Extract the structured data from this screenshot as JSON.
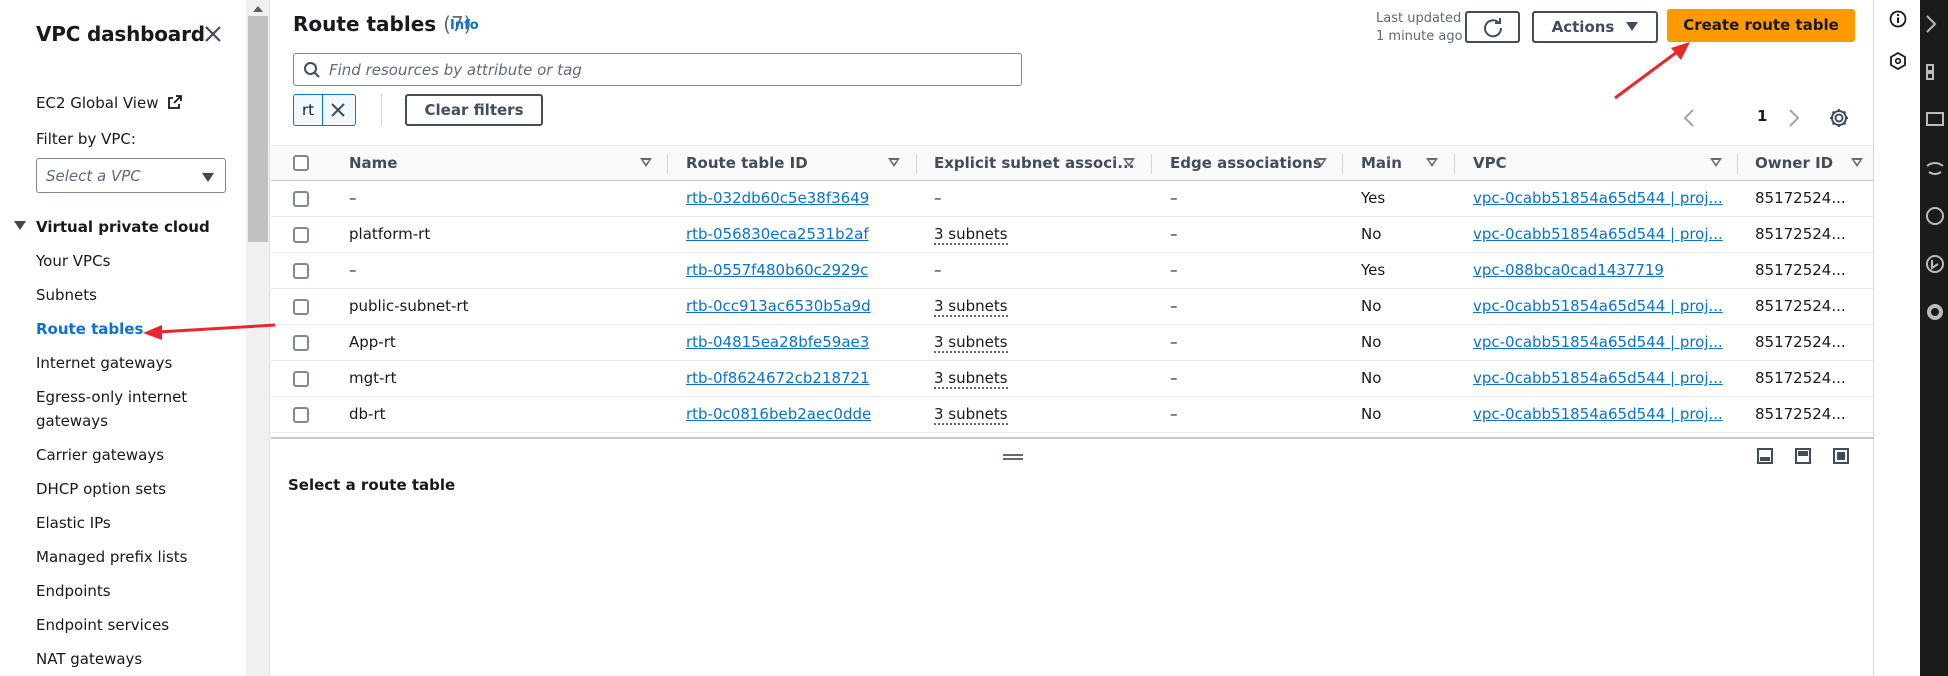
{
  "sidebar": {
    "title": "VPC dashboard",
    "ec2_global_view": "EC2 Global View",
    "filter_label": "Filter by VPC:",
    "vpc_select_placeholder": "Select a VPC",
    "section": "Virtual private cloud",
    "items": [
      {
        "label": "Your VPCs"
      },
      {
        "label": "Subnets"
      },
      {
        "label": "Route tables"
      },
      {
        "label": "Internet gateways"
      },
      {
        "label": "Egress-only internet"
      },
      {
        "label": "gateways"
      },
      {
        "label": "Carrier gateways"
      },
      {
        "label": "DHCP option sets"
      },
      {
        "label": "Elastic IPs"
      },
      {
        "label": "Managed prefix lists"
      },
      {
        "label": "Endpoints"
      },
      {
        "label": "Endpoint services"
      },
      {
        "label": "NAT gateways"
      }
    ]
  },
  "header": {
    "title": "Route tables",
    "count": "(7)",
    "info": "Info",
    "last_updated_1": "Last updated",
    "last_updated_2": "1 minute ago",
    "actions": "Actions",
    "create": "Create route table"
  },
  "search": {
    "placeholder": "Find resources by attribute or tag"
  },
  "filters": {
    "token": "rt",
    "clear": "Clear filters"
  },
  "pagination": {
    "page": "1"
  },
  "table": {
    "columns": [
      "Name",
      "Route table ID",
      "Explicit subnet associ...",
      "Edge associations",
      "Main",
      "VPC",
      "Owner ID"
    ],
    "rows": [
      {
        "name": "–",
        "id": "rtb-032db60c5e38f3649",
        "subnets": "–",
        "edge": "–",
        "main": "Yes",
        "vpc": "vpc-0cabb51854a65d544 | proj...",
        "owner": "85172524..."
      },
      {
        "name": "platform-rt",
        "id": "rtb-056830eca2531b2af",
        "subnets": "3 subnets",
        "edge": "–",
        "main": "No",
        "vpc": "vpc-0cabb51854a65d544 | proj...",
        "owner": "85172524..."
      },
      {
        "name": "–",
        "id": "rtb-0557f480b60c2929c",
        "subnets": "–",
        "edge": "–",
        "main": "Yes",
        "vpc": "vpc-088bca0cad1437719",
        "owner": "85172524..."
      },
      {
        "name": "public-subnet-rt",
        "id": "rtb-0cc913ac6530b5a9d",
        "subnets": "3 subnets",
        "edge": "–",
        "main": "No",
        "vpc": "vpc-0cabb51854a65d544 | proj...",
        "owner": "85172524..."
      },
      {
        "name": "App-rt",
        "id": "rtb-04815ea28bfe59ae3",
        "subnets": "3 subnets",
        "edge": "–",
        "main": "No",
        "vpc": "vpc-0cabb51854a65d544 | proj...",
        "owner": "85172524..."
      },
      {
        "name": "mgt-rt",
        "id": "rtb-0f8624672cb218721",
        "subnets": "3 subnets",
        "edge": "–",
        "main": "No",
        "vpc": "vpc-0cabb51854a65d544 | proj...",
        "owner": "85172524..."
      },
      {
        "name": "db-rt",
        "id": "rtb-0c0816beb2aec0dde",
        "subnets": "3 subnets",
        "edge": "–",
        "main": "No",
        "vpc": "vpc-0cabb51854a65d544 | proj...",
        "owner": "85172524..."
      }
    ]
  },
  "detail": {
    "title": "Select a route table"
  },
  "colors": {
    "primary_button": "#ff9900",
    "link": "#0972d3",
    "annotation_arrow": "#e8262b"
  }
}
